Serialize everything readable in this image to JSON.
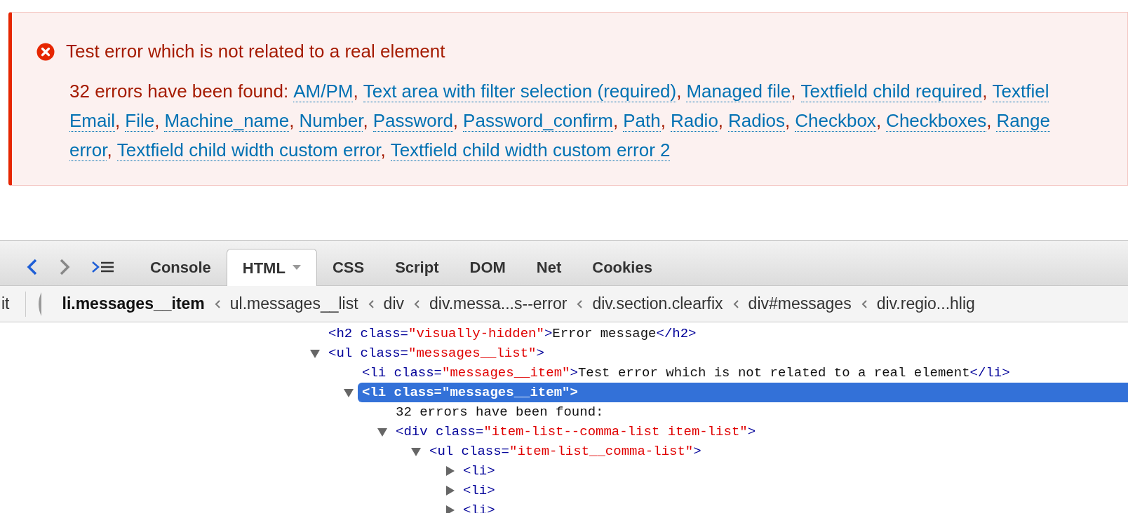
{
  "message": {
    "title": "Test error which is not related to a real element",
    "lines": [
      {
        "lead": "32 errors have been found:",
        "links": [
          {
            "text": "AM/PM",
            "separator": ","
          },
          {
            "text": "Text area with filter selection (required)",
            "separator": ","
          },
          {
            "text": "Managed file",
            "separator": ","
          },
          {
            "text": "Textfield child required",
            "separator": ","
          },
          {
            "text": "Textfiel"
          }
        ]
      },
      {
        "links": [
          {
            "text": "Email",
            "separator": ","
          },
          {
            "text": "File",
            "separator": ","
          },
          {
            "text": "Machine_name",
            "separator": ","
          },
          {
            "text": "Number",
            "separator": ","
          },
          {
            "text": "Password",
            "separator": ","
          },
          {
            "text": "Password_confirm",
            "separator": ","
          },
          {
            "text": "Path",
            "separator": ","
          },
          {
            "text": "Radio",
            "separator": ","
          },
          {
            "text": "Radios",
            "separator": ","
          },
          {
            "text": "Checkbox",
            "separator": ","
          },
          {
            "text": "Checkboxes",
            "separator": ","
          },
          {
            "text": "Range"
          }
        ]
      },
      {
        "links": [
          {
            "text": "error",
            "separator": ","
          },
          {
            "text": "Textfield child width custom error",
            "separator": ","
          },
          {
            "text": "Textfield child width custom error 2"
          }
        ]
      }
    ]
  },
  "devtools": {
    "tabs": [
      {
        "label": "Console",
        "selected": false,
        "dropdown": false
      },
      {
        "label": "HTML",
        "selected": true,
        "dropdown": true
      },
      {
        "label": "CSS",
        "selected": false,
        "dropdown": false
      },
      {
        "label": "Script",
        "selected": false,
        "dropdown": false
      },
      {
        "label": "DOM",
        "selected": false,
        "dropdown": false
      },
      {
        "label": "Net",
        "selected": false,
        "dropdown": false
      },
      {
        "label": "Cookies",
        "selected": false,
        "dropdown": false
      }
    ],
    "breadcrumb_cut": "it",
    "breadcrumbs": [
      {
        "label": "li.messages__item",
        "selected": true
      },
      {
        "label": "ul.messages__list",
        "selected": false
      },
      {
        "label": "div",
        "selected": false
      },
      {
        "label": "div.messa...s--error",
        "selected": false
      },
      {
        "label": "div.section.clearfix",
        "selected": false
      },
      {
        "label": "div#messages",
        "selected": false
      },
      {
        "label": "div.regio...hlig",
        "selected": false
      }
    ],
    "tree": [
      {
        "kind": "leaf",
        "selected": false,
        "tokens": [
          {
            "kind": "tag",
            "text": "<h2 "
          },
          {
            "kind": "attr",
            "text": "class="
          },
          {
            "kind": "value",
            "text": "\"visually-hidden\""
          },
          {
            "kind": "tag",
            "text": ">"
          },
          {
            "kind": "text",
            "text": "Error message"
          },
          {
            "kind": "tag",
            "text": "</h2>"
          }
        ]
      },
      {
        "kind": "branch",
        "expanded": true,
        "selected": false,
        "tokens": [
          {
            "kind": "tag",
            "text": "<ul "
          },
          {
            "kind": "attr",
            "text": "class="
          },
          {
            "kind": "value",
            "text": "\"messages__list\""
          },
          {
            "kind": "tag",
            "text": ">"
          }
        ],
        "children": [
          {
            "kind": "leaf",
            "selected": false,
            "tokens": [
              {
                "kind": "tag",
                "text": "<li "
              },
              {
                "kind": "attr",
                "text": "class="
              },
              {
                "kind": "value",
                "text": "\"messages__item\""
              },
              {
                "kind": "tag",
                "text": ">"
              },
              {
                "kind": "text",
                "text": "Test error which is not related to a real element"
              },
              {
                "kind": "tag",
                "text": "</li>"
              }
            ]
          },
          {
            "kind": "branch",
            "expanded": true,
            "selected": true,
            "tokens": [
              {
                "kind": "tag",
                "text": "<li "
              },
              {
                "kind": "attr",
                "text": "class="
              },
              {
                "kind": "value",
                "text": "\"messages__item\""
              },
              {
                "kind": "tag",
                "text": ">"
              }
            ],
            "children": [
              {
                "kind": "leaf",
                "selected": false,
                "tokens": [
                  {
                    "kind": "text",
                    "text": "32 errors have been found:"
                  }
                ]
              },
              {
                "kind": "branch",
                "expanded": true,
                "selected": false,
                "tokens": [
                  {
                    "kind": "tag",
                    "text": "<div "
                  },
                  {
                    "kind": "attr",
                    "text": "class="
                  },
                  {
                    "kind": "value",
                    "text": "\"item-list--comma-list item-list\""
                  },
                  {
                    "kind": "tag",
                    "text": ">"
                  }
                ],
                "children": [
                  {
                    "kind": "branch",
                    "expanded": true,
                    "selected": false,
                    "tokens": [
                      {
                        "kind": "tag",
                        "text": "<ul "
                      },
                      {
                        "kind": "attr",
                        "text": "class="
                      },
                      {
                        "kind": "value",
                        "text": "\"item-list__comma-list\""
                      },
                      {
                        "kind": "tag",
                        "text": ">"
                      }
                    ],
                    "children": [
                      {
                        "kind": "branch",
                        "expanded": false,
                        "selected": false,
                        "tokens": [
                          {
                            "kind": "tag",
                            "text": "<li>"
                          }
                        ]
                      },
                      {
                        "kind": "branch",
                        "expanded": false,
                        "selected": false,
                        "tokens": [
                          {
                            "kind": "tag",
                            "text": "<li>"
                          }
                        ]
                      },
                      {
                        "kind": "branch",
                        "expanded": false,
                        "selected": false,
                        "tokens": [
                          {
                            "kind": "tag",
                            "text": "<li>"
                          }
                        ]
                      }
                    ]
                  }
                ]
              }
            ]
          }
        ]
      }
    ]
  }
}
